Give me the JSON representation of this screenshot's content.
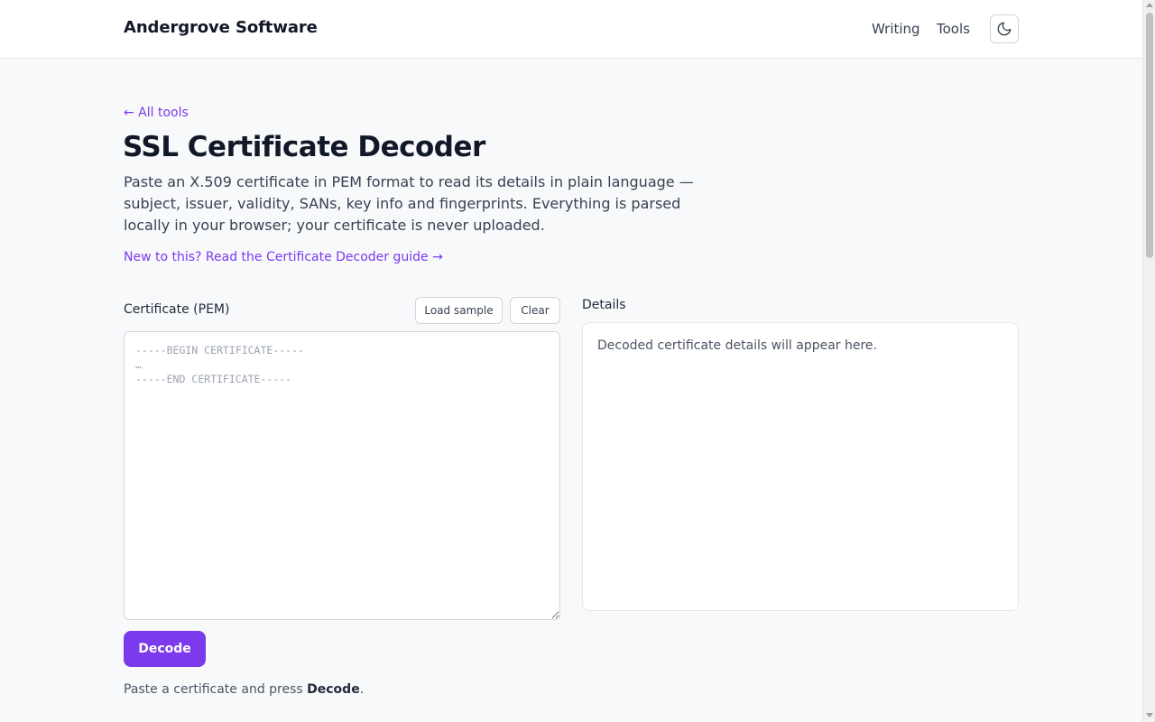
{
  "header": {
    "brand": "Andergrove Software",
    "nav": [
      {
        "label": "Writing"
      },
      {
        "label": "Tools"
      }
    ],
    "theme_toggle_icon": "moon-icon"
  },
  "page": {
    "back_link": "← All tools",
    "title": "SSL Certificate Decoder",
    "description": "Paste an X.509 certificate in PEM format to read its details in plain language — subject, issuer, validity, SANs, key info and fingerprints. Everything is parsed locally in your browser; your certificate is never uploaded.",
    "guide_link": "New to this? Read the Certificate Decoder guide →"
  },
  "input_panel": {
    "label": "Certificate (PEM)",
    "load_sample_label": "Load sample",
    "clear_label": "Clear",
    "value": "",
    "placeholder": "-----BEGIN CERTIFICATE-----\n…\n-----END CERTIFICATE-----"
  },
  "details_panel": {
    "label": "Details",
    "empty_message": "Decoded certificate details will appear here."
  },
  "actions": {
    "decode_label": "Decode"
  },
  "status": {
    "prefix": "Paste a certificate and press ",
    "emphasis": "Decode",
    "suffix": "."
  },
  "colors": {
    "accent": "#7c3aed",
    "background": "#f8f9fb",
    "text": "#111827"
  }
}
